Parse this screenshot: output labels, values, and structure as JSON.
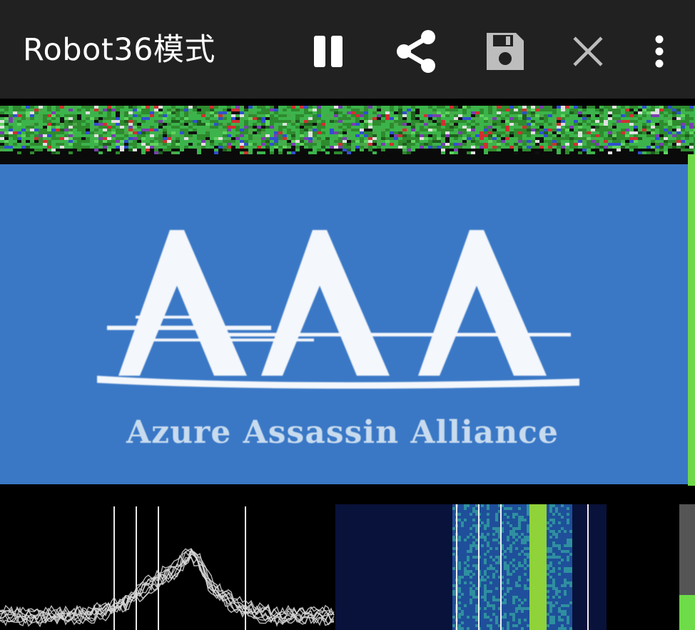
{
  "app": {
    "title": "Robot36模式"
  },
  "toolbar": {
    "actions": [
      {
        "name": "pause",
        "icon": "pause-icon"
      },
      {
        "name": "share",
        "icon": "share-icon"
      },
      {
        "name": "save",
        "icon": "save-icon"
      },
      {
        "name": "clear",
        "icon": "close-icon"
      },
      {
        "name": "more",
        "icon": "more-vertical-icon"
      }
    ]
  },
  "image": {
    "logo_letters": "AAA",
    "tagline": "Azure Assassin Alliance"
  },
  "meter": {
    "level": 0.28
  },
  "colors": {
    "toolbar_bg": "#212121",
    "decoded_bg": "#3a78c6",
    "meter_fill": "#6ddc48",
    "meter_bg": "#555555"
  }
}
